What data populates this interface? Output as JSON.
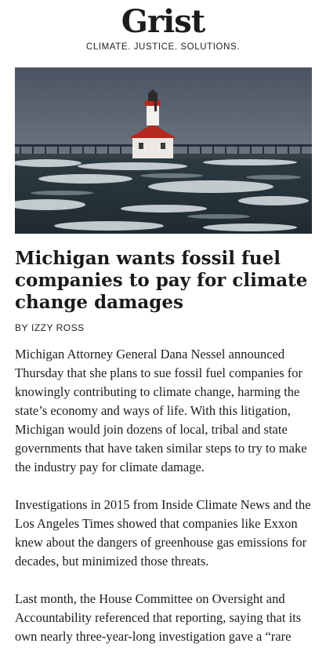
{
  "masthead": {
    "logo": "Grist",
    "tagline": "CLIMATE. JUSTICE. SOLUTIONS."
  },
  "hero_image": {
    "description_icon": "lighthouse-photo"
  },
  "article": {
    "headline": "Michigan wants fossil fuel companies to pay for climate change damages",
    "byline_prefix": "BY",
    "author": "IZZY ROSS",
    "paragraphs": [
      "Michigan Attorney General Dana Nessel announced Thursday that she plans to sue fossil fuel companies for knowingly contributing to climate change, harming the state’s economy and ways of life. With this litigation, Michigan would join dozens of local, tribal and state governments that have taken similar steps to try to make the industry pay for climate damage.",
      "Investigations in 2015 from Inside Climate News and the Los Angeles Times showed that companies like Exxon knew about the dangers of greenhouse gas emissions for decades, but minimized those threats.",
      "Last month, the House Committee on Oversight and Accountability referenced that reporting, saying that its own nearly three-year-long investigation gave a “rare"
    ]
  }
}
